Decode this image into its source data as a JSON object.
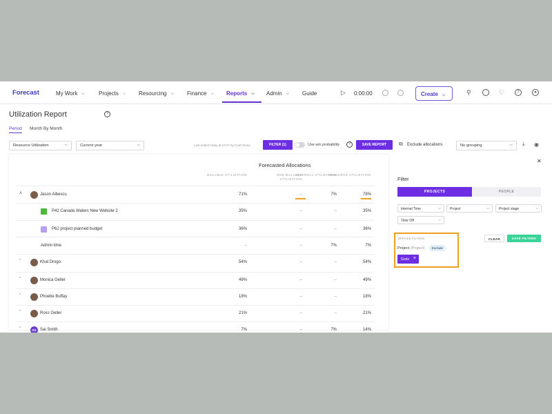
{
  "nav": {
    "logo": "Forecast",
    "items": [
      {
        "label": "My Work"
      },
      {
        "label": "Projects"
      },
      {
        "label": "Resourcing"
      },
      {
        "label": "Finance"
      },
      {
        "label": "Reports"
      },
      {
        "label": "Admin"
      },
      {
        "label": "Guide"
      }
    ],
    "active": "Reports",
    "timer": "0:00:00",
    "create_label": "Create",
    "accent_color": "#6230d0"
  },
  "header": {
    "title": "Utilization Report",
    "tabs": [
      {
        "label": "Period"
      },
      {
        "label": "Month By Month"
      }
    ],
    "report_type": "Resource Utilization",
    "period": "Current year",
    "last_edited": "Last edited today at 10:47 by Coen Dona",
    "filter_button": "FILTER (1)",
    "win_probability_label": "Use win probability",
    "save_report": "SAVE REPORT",
    "exclude_allocations": "Exclude allocations",
    "grouping": "No grouping"
  },
  "table": {
    "group_title": "Forecasted Allocations",
    "columns": [
      "BILLABLE UTILIZATION",
      "NON BILLABLE UTILIZATION",
      "INTERNAL UTILIZATION",
      "RESOURCE UTILIZATION"
    ],
    "rows": [
      {
        "label": "Jason Albescu",
        "values": [
          "71%",
          "–",
          "7%",
          "78%"
        ]
      },
      {
        "label": "P42 Canada Waters New Website 2",
        "values": [
          "35%",
          "–",
          "–",
          "35%"
        ]
      },
      {
        "label": "P62 project planned budget",
        "values": [
          "36%",
          "–",
          "–",
          "36%"
        ]
      },
      {
        "label": "Admin time",
        "values": [
          "–",
          "–",
          "7%",
          "7%"
        ]
      },
      {
        "label": "Khal Drogo",
        "values": [
          "54%",
          "–",
          "–",
          "54%"
        ]
      },
      {
        "label": "Monica Geller",
        "values": [
          "49%",
          "–",
          "–",
          "49%"
        ]
      },
      {
        "label": "Phoebe Buffay",
        "values": [
          "18%",
          "–",
          "–",
          "18%"
        ]
      },
      {
        "label": "Ross Geller",
        "values": [
          "21%",
          "–",
          "–",
          "21%"
        ]
      },
      {
        "label": "Sai Smith",
        "initials": "SS",
        "values": [
          "7%",
          "–",
          "7%",
          "14%"
        ]
      }
    ],
    "project_colors": [
      "#4fba3a",
      "#b9a0ee"
    ],
    "highlight_color": "#f0a020"
  },
  "filter": {
    "title": "Filter",
    "seg_projects": "PROJECTS",
    "seg_people": "PEOPLE",
    "selects": [
      "Internal Time",
      "Project",
      "Project stage",
      "Time Off"
    ],
    "applied_label": "APPLIED FILTERS",
    "applied_project": "Project",
    "applied_project_sub": "(Project)",
    "exclude_pill": "Exclude",
    "chip": "Gnds",
    "clear": "CLEAR",
    "save_filters": "SAVE FILTERS"
  }
}
